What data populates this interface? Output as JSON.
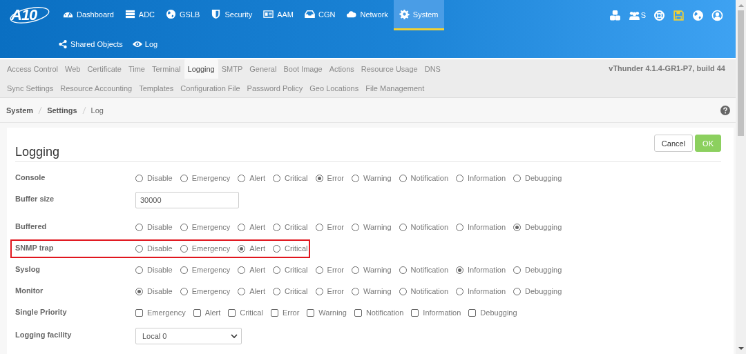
{
  "header": {
    "logo": "A10",
    "nav": [
      {
        "label": "Dashboard",
        "selected": false
      },
      {
        "label": "ADC",
        "selected": false
      },
      {
        "label": "GSLB",
        "selected": false
      },
      {
        "label": "Security",
        "selected": false
      },
      {
        "label": "AAM",
        "selected": false
      },
      {
        "label": "CGN",
        "selected": false
      },
      {
        "label": "Network",
        "selected": false
      },
      {
        "label": "System",
        "selected": true
      }
    ],
    "subnav": [
      {
        "label": "Shared Objects"
      },
      {
        "label": "Log"
      }
    ],
    "partition_label": "S"
  },
  "settings_tabs": [
    [
      {
        "label": "Access Control",
        "selected": false
      },
      {
        "label": "Web",
        "selected": false
      },
      {
        "label": "Certificate",
        "selected": false
      },
      {
        "label": "Time",
        "selected": false
      },
      {
        "label": "Terminal",
        "selected": false
      },
      {
        "label": "Logging",
        "selected": true
      },
      {
        "label": "SMTP",
        "selected": false
      },
      {
        "label": "General",
        "selected": false
      },
      {
        "label": "Boot Image",
        "selected": false
      },
      {
        "label": "Actions",
        "selected": false
      },
      {
        "label": "Resource Usage",
        "selected": false
      },
      {
        "label": "DNS",
        "selected": false
      }
    ],
    [
      {
        "label": "Sync Settings",
        "selected": false
      },
      {
        "label": "Resource Accounting",
        "selected": false
      },
      {
        "label": "Templates",
        "selected": false
      },
      {
        "label": "Configuration File",
        "selected": false
      },
      {
        "label": "Password Policy",
        "selected": false
      },
      {
        "label": "Geo Locations",
        "selected": false
      },
      {
        "label": "File Management",
        "selected": false
      }
    ]
  ],
  "version": "vThunder 4.1.4-GR1-P7, build 44",
  "breadcrumb": [
    "System",
    "Settings",
    "Log"
  ],
  "panel": {
    "title": "Logging",
    "buttons": [
      {
        "label": "Cancel",
        "kind": "default"
      },
      {
        "label": "OK",
        "kind": "primary"
      }
    ],
    "fields": [
      {
        "kind": "radio",
        "label": "Console",
        "highlighted": false,
        "options": [
          {
            "label": "Disable",
            "selected": false
          },
          {
            "label": "Emergency",
            "selected": false
          },
          {
            "label": "Alert",
            "selected": false
          },
          {
            "label": "Critical",
            "selected": false
          },
          {
            "label": "Error",
            "selected": true
          },
          {
            "label": "Warning",
            "selected": false
          },
          {
            "label": "Notification",
            "selected": false
          },
          {
            "label": "Information",
            "selected": false
          },
          {
            "label": "Debugging",
            "selected": false
          }
        ]
      },
      {
        "kind": "input",
        "label": "Buffer size",
        "highlighted": false,
        "value": "30000"
      },
      {
        "kind": "radio",
        "label": "Buffered",
        "highlighted": false,
        "options": [
          {
            "label": "Disable",
            "selected": false
          },
          {
            "label": "Emergency",
            "selected": false
          },
          {
            "label": "Alert",
            "selected": false
          },
          {
            "label": "Critical",
            "selected": false
          },
          {
            "label": "Error",
            "selected": false
          },
          {
            "label": "Warning",
            "selected": false
          },
          {
            "label": "Notification",
            "selected": false
          },
          {
            "label": "Information",
            "selected": false
          },
          {
            "label": "Debugging",
            "selected": true
          }
        ]
      },
      {
        "kind": "radio",
        "label": "SNMP trap",
        "highlighted": true,
        "options": [
          {
            "label": "Disable",
            "selected": false
          },
          {
            "label": "Emergency",
            "selected": false
          },
          {
            "label": "Alert",
            "selected": true
          },
          {
            "label": "Critical",
            "selected": false
          }
        ]
      },
      {
        "kind": "radio",
        "label": "Syslog",
        "highlighted": false,
        "options": [
          {
            "label": "Disable",
            "selected": false
          },
          {
            "label": "Emergency",
            "selected": false
          },
          {
            "label": "Alert",
            "selected": false
          },
          {
            "label": "Critical",
            "selected": false
          },
          {
            "label": "Error",
            "selected": false
          },
          {
            "label": "Warning",
            "selected": false
          },
          {
            "label": "Notification",
            "selected": false
          },
          {
            "label": "Information",
            "selected": true
          },
          {
            "label": "Debugging",
            "selected": false
          }
        ]
      },
      {
        "kind": "radio",
        "label": "Monitor",
        "highlighted": false,
        "options": [
          {
            "label": "Disable",
            "selected": true
          },
          {
            "label": "Emergency",
            "selected": false
          },
          {
            "label": "Alert",
            "selected": false
          },
          {
            "label": "Critical",
            "selected": false
          },
          {
            "label": "Error",
            "selected": false
          },
          {
            "label": "Warning",
            "selected": false
          },
          {
            "label": "Notification",
            "selected": false
          },
          {
            "label": "Information",
            "selected": false
          },
          {
            "label": "Debugging",
            "selected": false
          }
        ]
      },
      {
        "kind": "checkbox",
        "label": "Single Priority",
        "highlighted": false,
        "options": [
          {
            "label": "Emergency",
            "checked": false
          },
          {
            "label": "Alert",
            "checked": false
          },
          {
            "label": "Critical",
            "checked": false
          },
          {
            "label": "Error",
            "checked": false
          },
          {
            "label": "Warning",
            "checked": false
          },
          {
            "label": "Notification",
            "checked": false
          },
          {
            "label": "Information",
            "checked": false
          },
          {
            "label": "Debugging",
            "checked": false
          }
        ]
      },
      {
        "kind": "select",
        "label": "Logging facility",
        "highlighted": false,
        "value": "Local 0"
      }
    ]
  }
}
